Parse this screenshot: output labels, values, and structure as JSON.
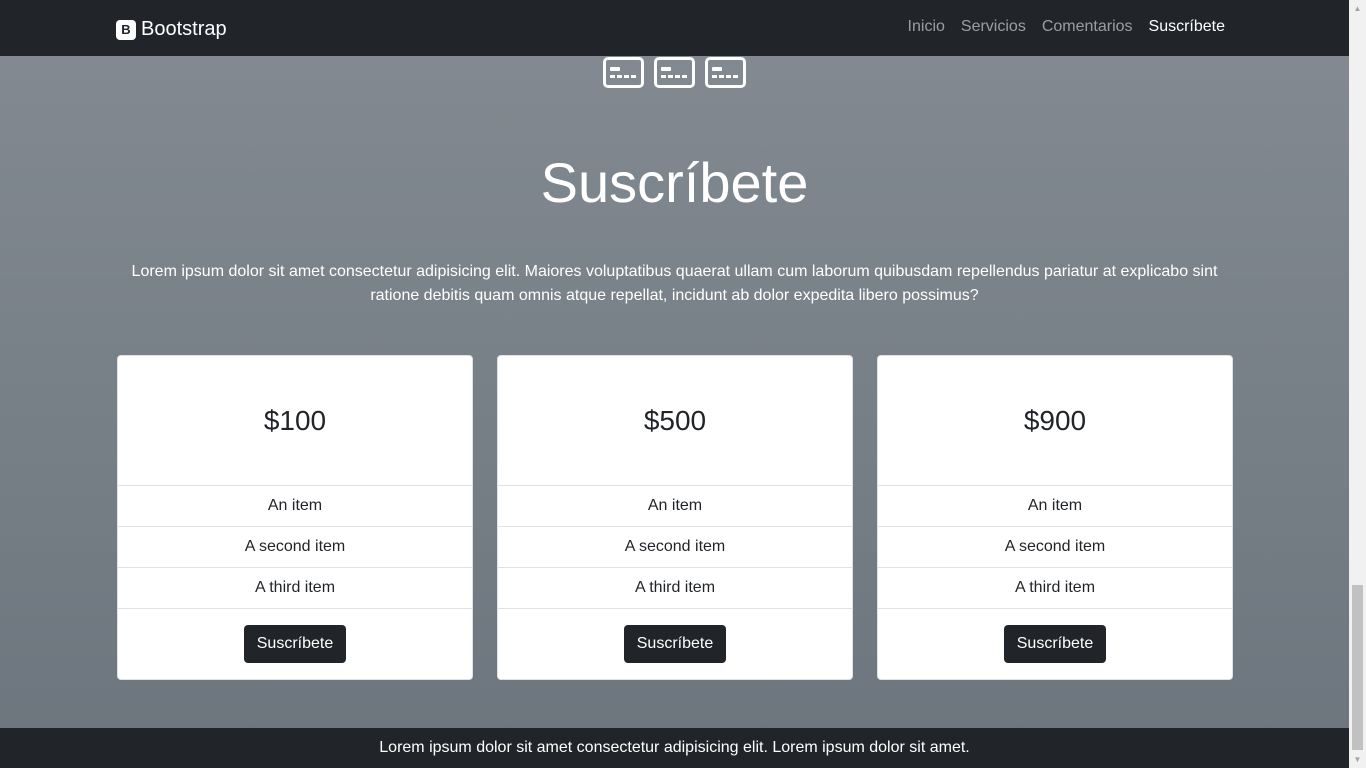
{
  "navbar": {
    "brand_logo": "B",
    "brand_name": "Bootstrap",
    "links": [
      {
        "label": "Inicio",
        "active": false
      },
      {
        "label": "Servicios",
        "active": false
      },
      {
        "label": "Comentarios",
        "active": false
      },
      {
        "label": "Suscríbete",
        "active": true
      }
    ]
  },
  "icons": [
    "credit-card-icon",
    "credit-card-icon",
    "credit-card-icon"
  ],
  "section": {
    "title": "Suscríbete",
    "description": "Lorem ipsum dolor sit amet consectetur adipisicing elit. Maiores voluptatibus quaerat ullam cum laborum quibusdam repellendus pariatur at explicabo sint ratione debitis quam omnis atque repellat, incidunt ab dolor expedita libero possimus?"
  },
  "plans": [
    {
      "price": "$100",
      "items": [
        "An item",
        "A second item",
        "A third item"
      ],
      "button": "Suscríbete"
    },
    {
      "price": "$500",
      "items": [
        "An item",
        "A second item",
        "A third item"
      ],
      "button": "Suscríbete"
    },
    {
      "price": "$900",
      "items": [
        "An item",
        "A second item",
        "A third item"
      ],
      "button": "Suscríbete"
    }
  ],
  "footer": {
    "text": "Lorem ipsum dolor sit amet consectetur adipisicing elit. Lorem ipsum dolor sit amet."
  },
  "colors": {
    "navbar_bg": "#212529",
    "section_bg": "#6c757d",
    "button_bg": "#212529"
  }
}
